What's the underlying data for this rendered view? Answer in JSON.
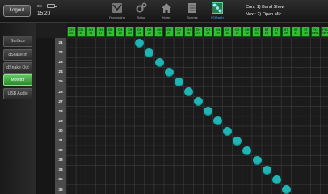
{
  "topbar": {
    "logout_label": "Logout",
    "device_name": "ttts",
    "battery_icon": "battery-icon",
    "clock": "15:20",
    "nav": [
      {
        "label": "Processing",
        "icon": "processing-icon"
      },
      {
        "label": "Setup",
        "icon": "gear-icon"
      },
      {
        "label": "Home",
        "icon": "home-icon"
      },
      {
        "label": "Scenes",
        "icon": "scenes-icon"
      },
      {
        "label": "I/OPatch",
        "icon": "patch-grid-icon",
        "active": true
      }
    ],
    "current_scene": "Curr: 1) Band Show",
    "next_scene": "Next: 2) Open Mic"
  },
  "sidebar": {
    "items": [
      {
        "label": "Surface",
        "active": false
      },
      {
        "label": "dSnake In",
        "active": false
      },
      {
        "label": "dSnake Out",
        "active": false
      },
      {
        "label": "Monitor",
        "active": true
      },
      {
        "label": "USB Audio",
        "active": false
      }
    ]
  },
  "patch": {
    "columns": [
      {
        "top": "CH",
        "bottom": "14"
      },
      {
        "top": "CH",
        "bottom": "15"
      },
      {
        "top": "CH",
        "bottom": "16"
      },
      {
        "top": "CH",
        "bottom": "17"
      },
      {
        "top": "CH",
        "bottom": "18"
      },
      {
        "top": "CH",
        "bottom": "19"
      },
      {
        "top": "CH",
        "bottom": "20"
      },
      {
        "top": "CH",
        "bottom": "21"
      },
      {
        "top": "CH",
        "bottom": "22"
      },
      {
        "top": "CH",
        "bottom": "23"
      },
      {
        "top": "CH",
        "bottom": "24"
      },
      {
        "top": "CH",
        "bottom": "25"
      },
      {
        "top": "CH",
        "bottom": "26"
      },
      {
        "top": "CH",
        "bottom": "27"
      },
      {
        "top": "CH",
        "bottom": "28"
      },
      {
        "top": "CH",
        "bottom": "29"
      },
      {
        "top": "CH",
        "bottom": "30"
      },
      {
        "top": "CH",
        "bottom": "31"
      },
      {
        "top": "CH",
        "bottom": "32"
      },
      {
        "top": "ST",
        "bottom": "1L"
      },
      {
        "top": "ST",
        "bottom": "1R"
      },
      {
        "top": "ST",
        "bottom": "2L"
      },
      {
        "top": "ST",
        "bottom": "2R"
      },
      {
        "top": "ST",
        "bottom": "3L"
      },
      {
        "top": "ST",
        "bottom": "3R"
      },
      {
        "top": "FX1",
        "bottom": "Ret L"
      },
      {
        "top": "FX1",
        "bottom": "Ret R"
      }
    ],
    "rows": [
      "21",
      "22",
      "23",
      "24",
      "25",
      "26",
      "27",
      "28",
      "29",
      "30",
      "31",
      "32",
      "33",
      "34",
      "35",
      "36"
    ],
    "connections": [
      {
        "row": "21",
        "col": "CH 21"
      },
      {
        "row": "22",
        "col": "CH 22"
      },
      {
        "row": "23",
        "col": "CH 23"
      },
      {
        "row": "24",
        "col": "CH 24"
      },
      {
        "row": "25",
        "col": "CH 25"
      },
      {
        "row": "26",
        "col": "CH 26"
      },
      {
        "row": "27",
        "col": "CH 27"
      },
      {
        "row": "28",
        "col": "CH 28"
      },
      {
        "row": "29",
        "col": "CH 29"
      },
      {
        "row": "30",
        "col": "CH 30"
      },
      {
        "row": "31",
        "col": "CH 31"
      },
      {
        "row": "32",
        "col": "CH 32"
      },
      {
        "row": "33",
        "col": "ST 1L"
      },
      {
        "row": "34",
        "col": "ST 1R"
      },
      {
        "row": "35",
        "col": "ST 2L"
      },
      {
        "row": "36",
        "col": "ST 2R"
      }
    ],
    "connection_color": "#1fb5b5",
    "header_color": "#2fbf2f"
  }
}
